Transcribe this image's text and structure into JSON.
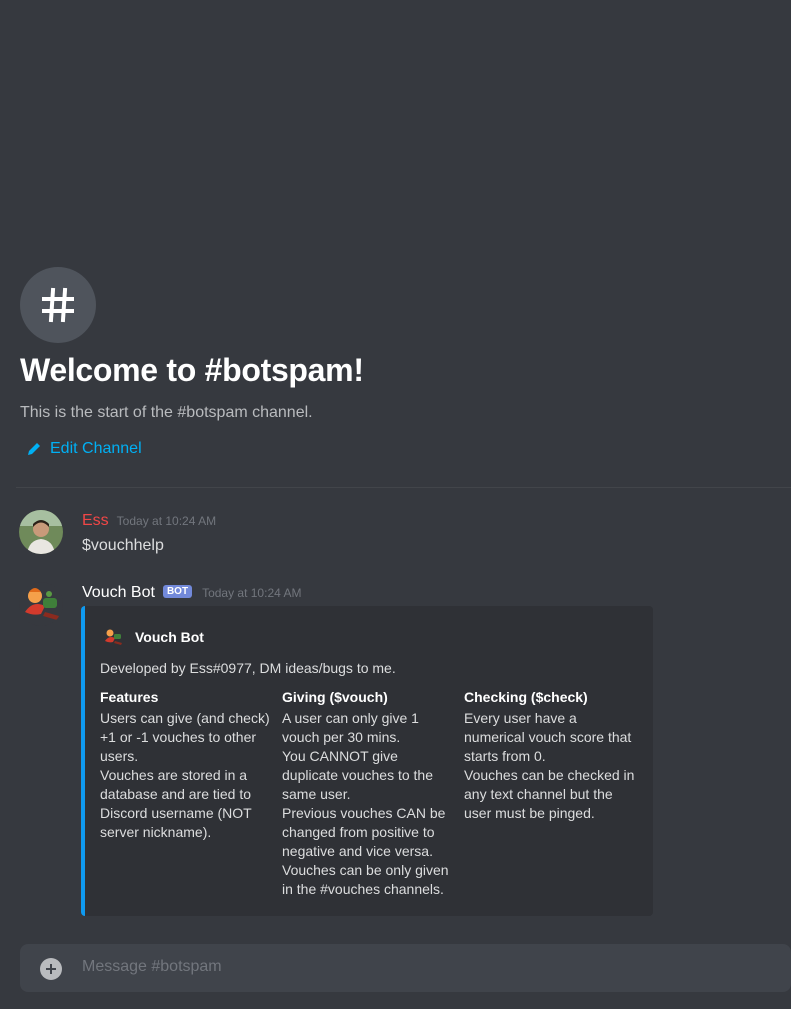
{
  "channel": {
    "welcome_title": "Welcome to #botspam!",
    "welcome_subtitle": "This is the start of the #botspam channel.",
    "edit_label": "Edit Channel"
  },
  "messages": [
    {
      "author": "Ess",
      "author_color": "#f04747",
      "timestamp": "Today at 10:24 AM",
      "content": "$vouchhelp"
    },
    {
      "author": "Vouch Bot",
      "author_color": "#ffffff",
      "bot_tag": "BOT",
      "timestamp": "Today at 10:24 AM",
      "embed": {
        "color": "#0f9af0",
        "author_name": "Vouch Bot",
        "description": "Developed by Ess#0977, DM ideas/bugs to me.",
        "fields": [
          {
            "name": "Features",
            "lines": [
              "Users can give (and check)",
              "+1 or -1 vouches to other",
              "users.",
              "Vouches are stored in a",
              "database and are tied to",
              "Discord username (NOT",
              "server nickname)."
            ]
          },
          {
            "name": "Giving ($vouch)",
            "lines": [
              "A user can only give 1",
              "vouch per 30 mins.",
              "You CANNOT give",
              "duplicate vouches to the",
              "same user.",
              "Previous vouches CAN be",
              "changed from positive to",
              "negative and vice versa.",
              "Vouches can be only given",
              "in the #vouches channels."
            ]
          },
          {
            "name": "Checking ($check)",
            "lines": [
              "Every user have a",
              "numerical vouch score that",
              "starts from 0.",
              "Vouches can be checked in",
              "any text channel but the",
              "user must be pinged."
            ]
          }
        ]
      }
    }
  ],
  "composer": {
    "placeholder": "Message #botspam"
  },
  "icons": {
    "channel": "hash-icon",
    "edit": "pencil-icon",
    "attach": "plus-circle-icon"
  }
}
